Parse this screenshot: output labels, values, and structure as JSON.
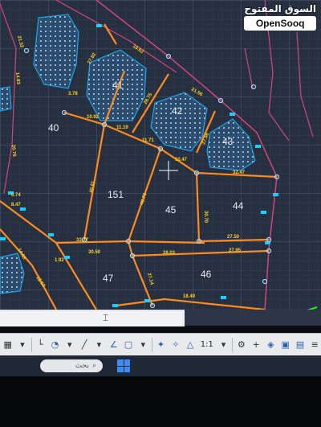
{
  "watermark": {
    "arabic": "السوق المفتوح",
    "english": "OpenSooq"
  },
  "lots": {
    "l40": "40",
    "l41": "41",
    "l42": "42",
    "l43": "43",
    "l44": "44",
    "l45": "45",
    "l46": "46",
    "l47": "47",
    "l151": "151"
  },
  "dims": {
    "d1": "27.82",
    "d2": "19.62",
    "d3": "21.32",
    "d4": "14.83",
    "d5": "28.75",
    "d6": "10.92",
    "d7": "11.19",
    "d8": "11.71",
    "d9": "21.56",
    "d10": "10.47",
    "d11": "32.47",
    "d12": "27.56",
    "d13": "20.76",
    "d14": "40.61",
    "d15": "40.70",
    "d16": "27.50",
    "d17": "27.95",
    "d18": "30.50",
    "d19": "28.03",
    "d20": "33.77",
    "d21": "30.70",
    "d22": "27.14",
    "d23": "18.49",
    "d24": "14.03",
    "d25": "0.74",
    "d26": "8.47",
    "d27": "1.92",
    "d28": "12.63",
    "d29": "3.78"
  },
  "colors": {
    "boundary": "#ff8a1e",
    "lot_outline": "#1fa4e8",
    "lot_fill": "#2f7fc1",
    "road": "#d6447a",
    "dim_text": "#ffd21f",
    "cyan_marker": "#18d0ff"
  },
  "taskbar": {
    "search_placeholder": "بحث"
  },
  "toolbar": {
    "scale_label": "1:1"
  }
}
